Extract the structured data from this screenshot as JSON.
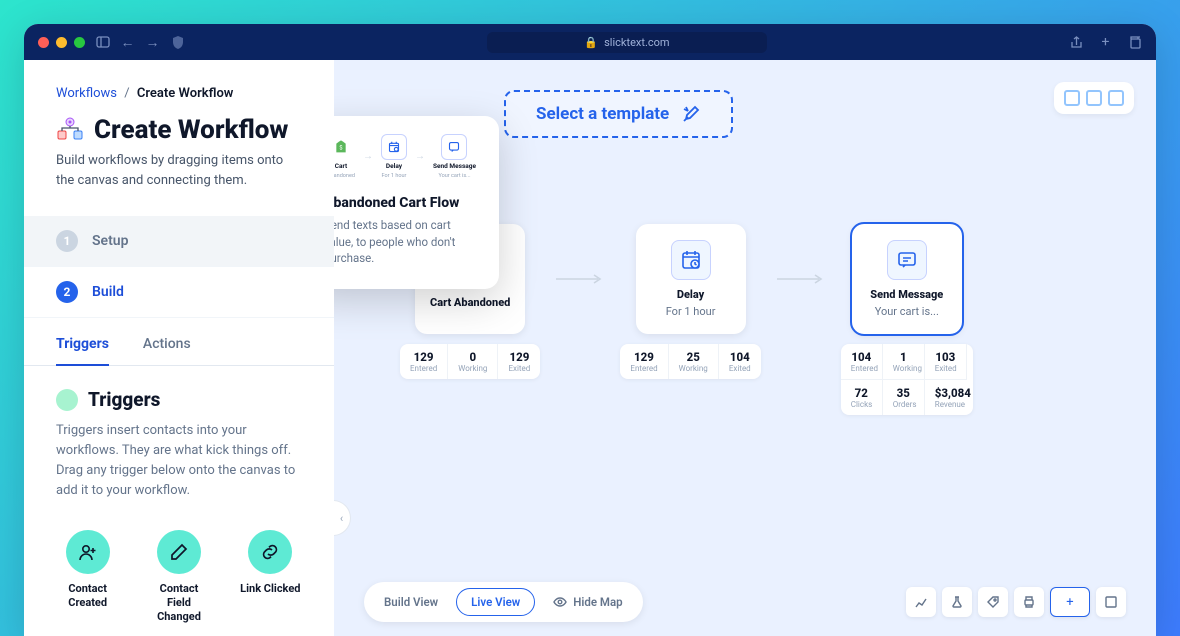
{
  "browser": {
    "url": "slicktext.com"
  },
  "breadcrumb": {
    "root": "Workflows",
    "sep": "/",
    "current": "Create Workflow"
  },
  "header": {
    "title": "Create Workflow",
    "subtitle": "Build workflows by dragging items onto the canvas and connecting them."
  },
  "steps": [
    {
      "num": "1",
      "label": "Setup"
    },
    {
      "num": "2",
      "label": "Build"
    }
  ],
  "tabs": [
    {
      "label": "Triggers"
    },
    {
      "label": "Actions"
    }
  ],
  "panel": {
    "title": "Triggers",
    "desc": "Triggers insert contacts into your workflows. They are what kick things off. Drag any trigger below onto the canvas to add it to your workflow."
  },
  "triggers": [
    {
      "label": "Contact Created"
    },
    {
      "label": "Contact Field Changed"
    },
    {
      "label": "Link Clicked"
    }
  ],
  "template_btn": "Select a template",
  "popup": {
    "title": "Abandoned Cart Flow",
    "desc": "Send texts based on cart value, to people who don't purchase.",
    "mini": [
      {
        "t": "Cart",
        "s": "Abandoned"
      },
      {
        "t": "Delay",
        "s": "For 1 hour"
      },
      {
        "t": "Send Message",
        "s": "Your cart is..."
      }
    ]
  },
  "nodes": [
    {
      "title": "Cart Abandoned",
      "sub": "",
      "stats": [
        {
          "v": "129",
          "l": "Entered"
        },
        {
          "v": "0",
          "l": "Working"
        },
        {
          "v": "129",
          "l": "Exited"
        }
      ]
    },
    {
      "title": "Delay",
      "sub": "For 1 hour",
      "stats": [
        {
          "v": "129",
          "l": "Entered"
        },
        {
          "v": "25",
          "l": "Working"
        },
        {
          "v": "104",
          "l": "Exited"
        }
      ]
    },
    {
      "title": "Send Message",
      "sub": "Your cart is...",
      "stats": [
        {
          "v": "104",
          "l": "Entered"
        },
        {
          "v": "1",
          "l": "Working"
        },
        {
          "v": "103",
          "l": "Exited"
        },
        {
          "v": "72",
          "l": "Clicks"
        },
        {
          "v": "35",
          "l": "Orders"
        },
        {
          "v": "$3,084",
          "l": "Revenue"
        }
      ]
    }
  ],
  "bottombar": {
    "build": "Build View",
    "live": "Live View",
    "hide": "Hide Map"
  }
}
